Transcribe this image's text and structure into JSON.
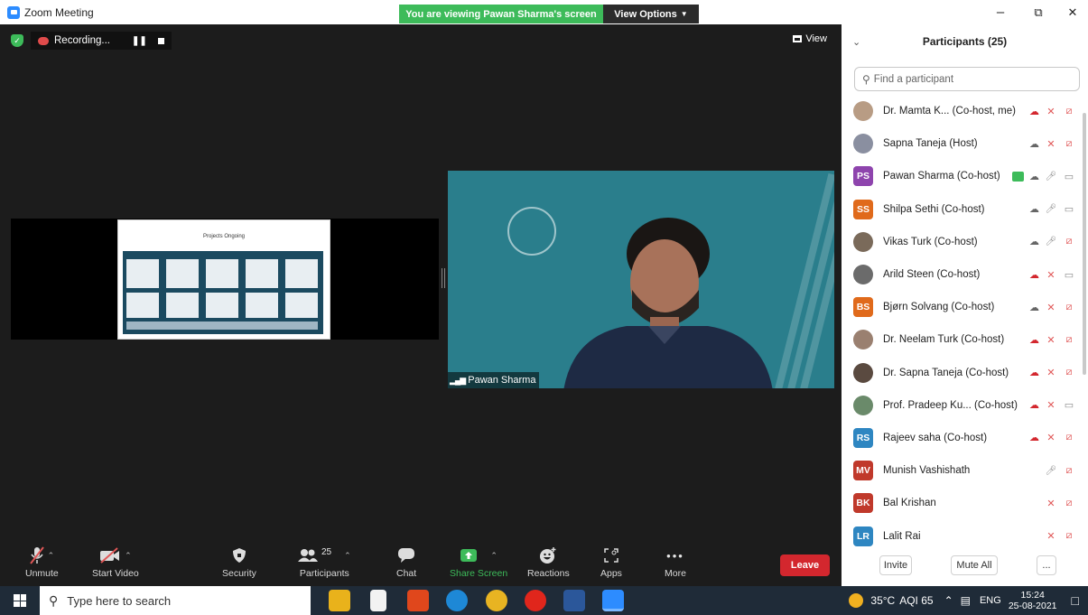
{
  "titlebar": {
    "title": "Zoom Meeting",
    "viewing_banner": "You are viewing Pawan Sharma's screen",
    "view_options": "View Options"
  },
  "window_controls": {
    "minimize": "–",
    "restore": "⧉",
    "close": "✕"
  },
  "meeting": {
    "recording_label": "Recording...",
    "view_label": "View",
    "slide_title": "Projects Ongoing",
    "speaker_name": "Pawan Sharma"
  },
  "toolbar": {
    "unmute": "Unmute",
    "start_video": "Start Video",
    "security": "Security",
    "participants": "Participants",
    "participants_count": "25",
    "chat": "Chat",
    "share_screen": "Share Screen",
    "reactions": "Reactions",
    "apps": "Apps",
    "more": "More",
    "leave": "Leave"
  },
  "panel": {
    "title": "Participants (25)",
    "search_placeholder": "Find a participant",
    "invite": "Invite",
    "mute_all": "Mute All",
    "more": "...",
    "participants": [
      {
        "name": "Dr. Mamta K...  (Co-host, me)",
        "avatar": "",
        "avatar_color": "#b89c84",
        "rec": "red",
        "mic": "muted",
        "cam": "off"
      },
      {
        "name": "Sapna Taneja (Host)",
        "avatar": "",
        "avatar_color": "#8a8fa0",
        "rec": "grey",
        "mic": "muted",
        "cam": "off"
      },
      {
        "name": "Pawan Sharma (Co-host)",
        "avatar": "PS",
        "avatar_color": "#8e44ad",
        "rec": "grey",
        "mic": "on",
        "cam": "on",
        "sharing": true
      },
      {
        "name": "Shilpa Sethi (Co-host)",
        "avatar": "SS",
        "avatar_color": "#e06a1b",
        "rec": "grey",
        "mic": "on",
        "cam": "on"
      },
      {
        "name": "Vikas Turk (Co-host)",
        "avatar": "",
        "avatar_color": "#7a6a5a",
        "rec": "grey",
        "mic": "on",
        "cam": "off"
      },
      {
        "name": "Arild Steen (Co-host)",
        "avatar": "",
        "avatar_color": "#6b6b6b",
        "rec": "red",
        "mic": "muted",
        "cam": "on"
      },
      {
        "name": "Bjørn Solvang (Co-host)",
        "avatar": "BS",
        "avatar_color": "#e06a1b",
        "rec": "grey",
        "mic": "muted",
        "cam": "off"
      },
      {
        "name": "Dr. Neelam Turk (Co-host)",
        "avatar": "",
        "avatar_color": "#9a8070",
        "rec": "red",
        "mic": "muted",
        "cam": "off"
      },
      {
        "name": "Dr. Sapna Taneja (Co-host)",
        "avatar": "",
        "avatar_color": "#5a4a40",
        "rec": "red",
        "mic": "muted",
        "cam": "off"
      },
      {
        "name": "Prof. Pradeep Ku...  (Co-host)",
        "avatar": "",
        "avatar_color": "#6a8a6a",
        "rec": "red",
        "mic": "muted",
        "cam": "on"
      },
      {
        "name": "Rajeev saha (Co-host)",
        "avatar": "RS",
        "avatar_color": "#2e86c1",
        "rec": "red",
        "mic": "muted",
        "cam": "off"
      },
      {
        "name": "Munish Vashishath",
        "avatar": "MV",
        "avatar_color": "#c0392b",
        "rec": "",
        "mic": "on",
        "cam": "off"
      },
      {
        "name": "Bal Krishan",
        "avatar": "BK",
        "avatar_color": "#c0392b",
        "rec": "",
        "mic": "muted",
        "cam": "off"
      },
      {
        "name": "Lalit Rai",
        "avatar": "LR",
        "avatar_color": "#2e86c1",
        "rec": "",
        "mic": "muted",
        "cam": "off"
      }
    ]
  },
  "taskbar": {
    "search_placeholder": "Type here to search",
    "temperature": "35°C",
    "aqi": "AQI 65",
    "language": "ENG",
    "time": "15:24",
    "date": "25-08-2021"
  },
  "colors": {
    "leave": "#d3272e",
    "banner": "#3dbb5a",
    "share": "#3dbb5a",
    "accent": "#2d8cff"
  }
}
